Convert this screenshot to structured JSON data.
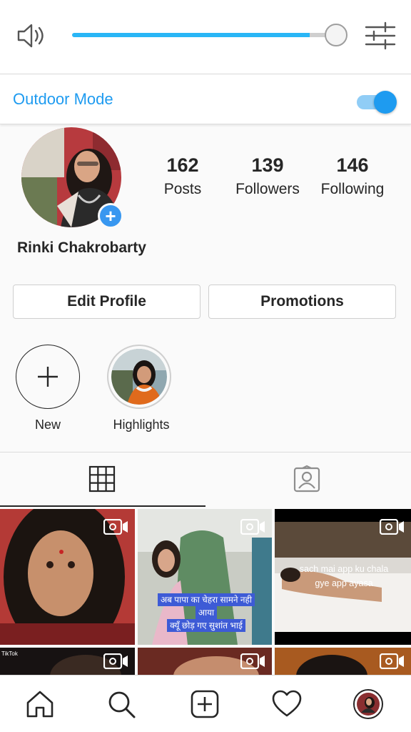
{
  "volume_panel": {
    "level": 0.9,
    "track_color": "#29b6f6",
    "outdoor_mode_label": "Outdoor Mode",
    "outdoor_mode_on": true,
    "accent_color": "#1e9bf0"
  },
  "profile": {
    "name": "Rinki Chakrobarty",
    "stats": [
      {
        "value": "162",
        "label": "Posts"
      },
      {
        "value": "139",
        "label": "Followers"
      },
      {
        "value": "146",
        "label": "Following"
      }
    ],
    "edit_profile_label": "Edit Profile",
    "promotions_label": "Promotions",
    "add_badge_color": "#3897f0"
  },
  "highlights": [
    {
      "label": "New",
      "icon": "plus-icon"
    },
    {
      "label": "Highlights",
      "icon": "highlight-photo"
    }
  ],
  "tabs": [
    {
      "name": "grid",
      "icon": "grid-icon",
      "active": true
    },
    {
      "name": "tagged",
      "icon": "tagged-person-icon",
      "active": false
    }
  ],
  "posts": [
    {
      "caption": "",
      "icon": "video-icon"
    },
    {
      "caption_lines": [
        "अब पापा का चेहरा सामने नही",
        "आया",
        "क्यूँ छोड़ गए सुशांत भाई"
      ],
      "icon": "video-icon"
    },
    {
      "caption_lines": [
        "sach mai app ku chala",
        "gye app ayasa"
      ],
      "icon": "video-icon"
    },
    {
      "caption": "TikTok",
      "icon": "video-icon"
    },
    {
      "caption": "",
      "icon": "video-icon"
    },
    {
      "caption": "",
      "icon": "video-icon"
    }
  ],
  "bottom_nav": [
    {
      "name": "home",
      "icon": "home-icon"
    },
    {
      "name": "search",
      "icon": "search-icon"
    },
    {
      "name": "new-post",
      "icon": "add-post-icon"
    },
    {
      "name": "activity",
      "icon": "heart-icon"
    },
    {
      "name": "profile",
      "icon": "profile-avatar"
    }
  ]
}
